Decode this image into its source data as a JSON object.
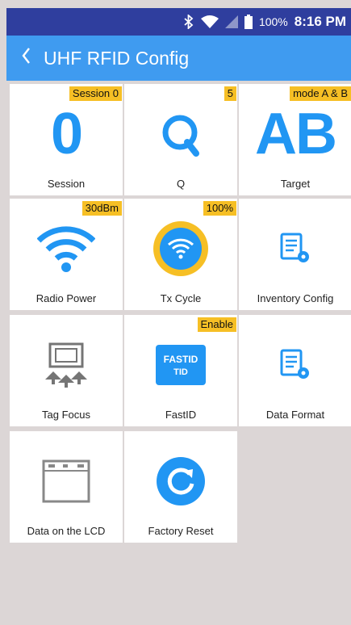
{
  "status": {
    "battery": "100%",
    "time": "8:16 PM",
    "icons": [
      "bluetooth-icon",
      "wifi-icon",
      "no-signal-icon",
      "battery-icon"
    ]
  },
  "appbar": {
    "back_icon": "chevron-left-icon",
    "title": "UHF RFID Config"
  },
  "tiles": {
    "session": {
      "label": "Session",
      "badge": "Session 0",
      "glyph": "0"
    },
    "q": {
      "label": "Q",
      "badge": "5",
      "glyph": "Q"
    },
    "target": {
      "label": "Target",
      "badge": "mode A & B",
      "glyph": "AB"
    },
    "radio_power": {
      "label": "Radio Power",
      "badge": "30dBm",
      "icon": "wifi-signal-icon"
    },
    "tx_cycle": {
      "label": "Tx Cycle",
      "badge": "100%",
      "icon": "wifi-circle-icon"
    },
    "inventory_config": {
      "label": "Inventory Config",
      "icon": "document-gear-icon"
    },
    "tag_focus": {
      "label": "Tag Focus",
      "icon": "tag-focus-icon"
    },
    "fastid": {
      "label": "FastID",
      "badge": "Enable",
      "icon_text_top": "FASTID",
      "icon_text_bottom": "TID"
    },
    "data_format": {
      "label": "Data Format",
      "icon": "document-gear-icon"
    },
    "data_lcd": {
      "label": "Data on the LCD",
      "icon": "lcd-screen-icon"
    },
    "factory_reset": {
      "label": "Factory Reset",
      "icon": "reset-icon"
    }
  },
  "colors": {
    "primary": "#3f9bf0",
    "status": "#2f3e9e",
    "badge": "#f6bf25",
    "icon_blue": "#2196f3",
    "background": "#dcd6d6"
  }
}
